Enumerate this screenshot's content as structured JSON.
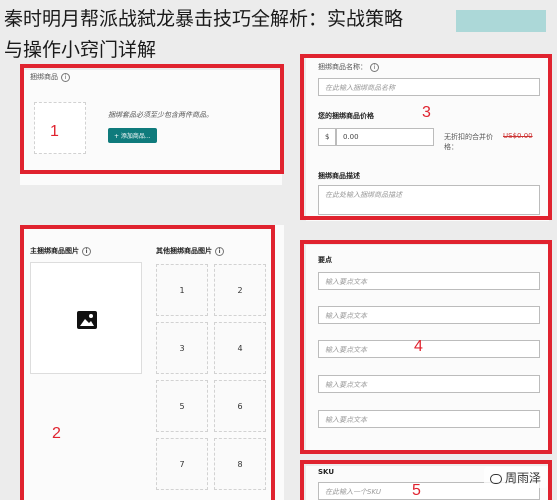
{
  "headline": {
    "line1": "秦时明月帮派战弑龙暴击技巧全解析：实战策略",
    "line2": "与操作小窍门详解"
  },
  "section1": {
    "title": "捆绑商品",
    "hint": "捆绑套品必须至少包含两件商品。",
    "add_button": "+ 添加商品...",
    "number": "1"
  },
  "section2": {
    "main_image_label": "主捆绑商品图片",
    "other_images_label": "其他捆绑商品图片",
    "image_icon": "image-icon",
    "slots": [
      "1",
      "2",
      "3",
      "4",
      "5",
      "6",
      "7",
      "8"
    ],
    "number": "2"
  },
  "section3": {
    "name_label": "捆绑商品名称：",
    "name_placeholder": "在此输入捆绑商品名称",
    "price_label": "您的捆绑商品价格",
    "currency": "$",
    "price_value": "0.00",
    "original_price_label": "无折扣的合并价格：",
    "original_price": "US$0.00",
    "desc_label": "捆绑商品描述",
    "desc_placeholder": "在此处输入捆绑商品描述",
    "number": "3"
  },
  "section4": {
    "label": "要点",
    "placeholders": [
      "输入要点文本",
      "输入要点文本",
      "输入要点文本",
      "输入要点文本",
      "输入要点文本"
    ],
    "number": "4"
  },
  "section5": {
    "label": "SKU",
    "placeholder": "在此输入一个SKU",
    "number": "5"
  },
  "watermark": "周雨泽",
  "colors": {
    "accent": "#e0232f",
    "button": "#0f7b7c"
  }
}
